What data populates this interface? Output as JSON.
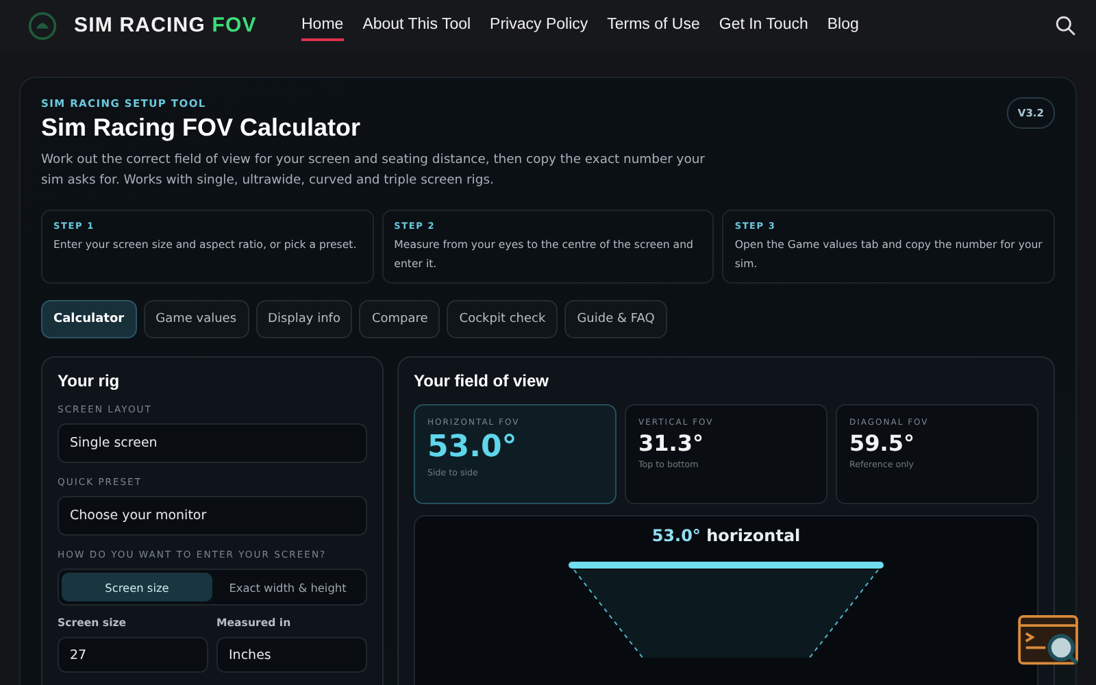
{
  "header": {
    "logo_text": "SIM RACING ",
    "logo_accent": "FOV",
    "nav": [
      {
        "label": "Home",
        "selected": true
      },
      {
        "label": "About This Tool",
        "selected": false
      },
      {
        "label": "Privacy Policy",
        "selected": false
      },
      {
        "label": "Terms of Use",
        "selected": false
      },
      {
        "label": "Get In Touch",
        "selected": false
      },
      {
        "label": "Blog",
        "selected": false
      }
    ]
  },
  "hero": {
    "eyebrow": "SIM RACING SETUP TOOL",
    "title": "Sim Racing FOV Calculator",
    "version": "V3.2",
    "description": "Work out the correct field of view for your screen and seating distance, then copy the exact number your sim asks for. Works with single, ultrawide, curved and triple screen rigs."
  },
  "steps": [
    {
      "label": "STEP 1",
      "text": "Enter your screen size and aspect ratio, or pick a preset."
    },
    {
      "label": "STEP 2",
      "text": "Measure from your eyes to the centre of the screen and enter it."
    },
    {
      "label": "STEP 3",
      "text": "Open the Game values tab and copy the number for your sim."
    }
  ],
  "tabs": [
    {
      "label": "Calculator",
      "selected": true
    },
    {
      "label": "Game values",
      "selected": false
    },
    {
      "label": "Display info",
      "selected": false
    },
    {
      "label": "Compare",
      "selected": false
    },
    {
      "label": "Cockpit check",
      "selected": false
    },
    {
      "label": "Guide & FAQ",
      "selected": false
    }
  ],
  "rig": {
    "title": "Your rig",
    "layout_label": "SCREEN LAYOUT",
    "layout_value": "Single screen",
    "preset_label": "QUICK PRESET",
    "preset_value": "Choose your monitor",
    "entry_label": "HOW DO YOU WANT TO ENTER YOUR SCREEN?",
    "entry_options": [
      {
        "label": "Screen size",
        "selected": true
      },
      {
        "label": "Exact width & height",
        "selected": false
      }
    ],
    "size_label": "Screen size",
    "size_value": "27",
    "unit_label": "Measured in",
    "unit_value": "Inches"
  },
  "fov": {
    "title": "Your field of view",
    "cards": [
      {
        "label": "HORIZONTAL FOV",
        "value": "53.0°",
        "note": "Side to side",
        "selected": true
      },
      {
        "label": "VERTICAL FOV",
        "value": "31.3°",
        "note": "Top to bottom",
        "selected": false
      },
      {
        "label": "DIAGONAL FOV",
        "value": "59.5°",
        "note": "Reference only",
        "selected": false
      }
    ],
    "diagram_angle": "53.0°",
    "diagram_caption": "horizontal"
  }
}
